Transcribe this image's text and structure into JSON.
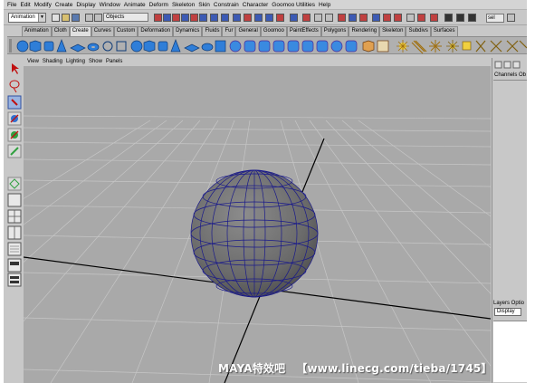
{
  "menu": [
    "File",
    "Edit",
    "Modify",
    "Create",
    "Display",
    "Window",
    "Animate",
    "Deform",
    "Skeleton",
    "Skin",
    "Constrain",
    "Character",
    "Goomoo Utilities",
    "Help"
  ],
  "status_line": {
    "mode": "Animation",
    "selection_field": "Objects",
    "sel_field": "sel"
  },
  "shelf_tabs": [
    "Animation",
    "Cloth",
    "Create",
    "Curves",
    "Custom",
    "Deformation",
    "Dynamics",
    "Fluids",
    "Fur",
    "General",
    "Goomoo",
    "PaintEffects",
    "Polygons",
    "Rendering",
    "Skeleton",
    "Subdivs",
    "Surfaces"
  ],
  "active_shelf_tab": "Create",
  "panel_menu": [
    "View",
    "Shading",
    "Lighting",
    "Show",
    "Panels"
  ],
  "channel_box": {
    "tabs": "Channels  Ob",
    "layer_tabs": "Layers  Optio",
    "display_select": "Display"
  },
  "watermark": {
    "brand": "MAYA特效吧",
    "link": "【www.linecg.com/tieba/1745】"
  },
  "colors": {
    "viewport_bg": "#a9a9a9",
    "grid": "#c4c4c4",
    "axis": "#000000",
    "sphere": "#6e6e6e",
    "wireframe": "#1a1a8a",
    "ui_bg": "#c8c8c8"
  }
}
